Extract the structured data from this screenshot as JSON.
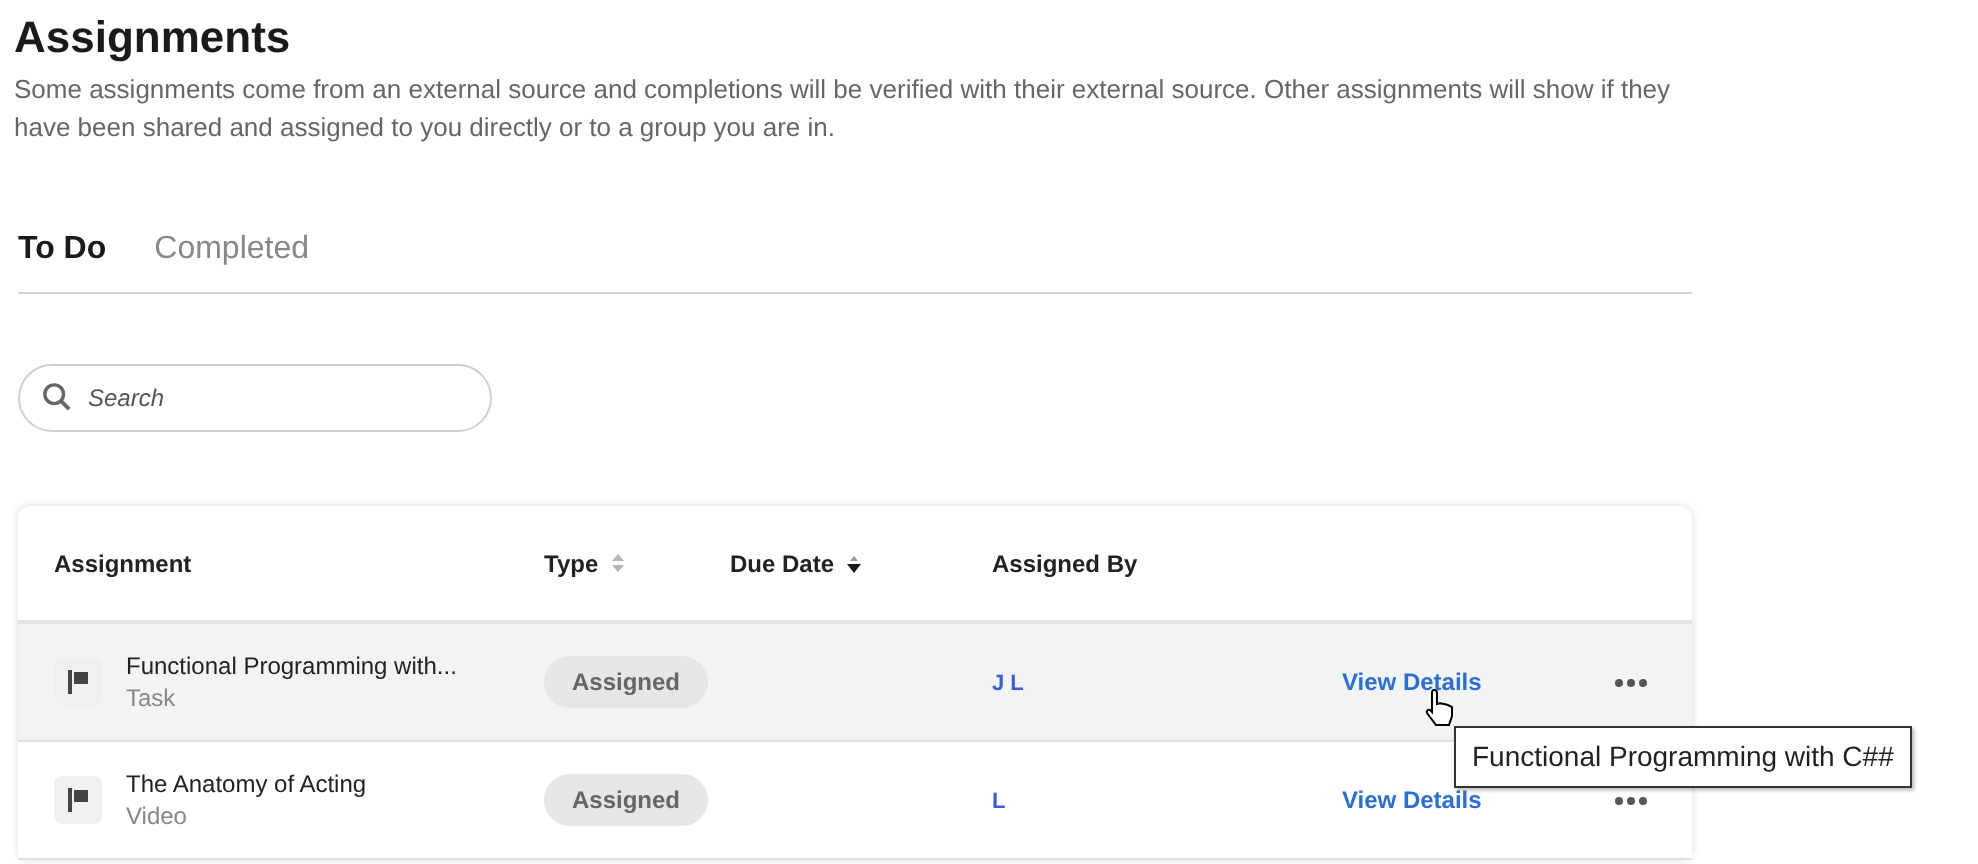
{
  "page": {
    "title": "Assignments",
    "description": "Some assignments come from an external source and completions will be verified with their external source. Other assignments will show if they have been shared and assigned to you directly or to a group you are in."
  },
  "tabs": [
    {
      "label": "To Do",
      "selected": true
    },
    {
      "label": "Completed",
      "selected": false
    }
  ],
  "search": {
    "placeholder": "Search"
  },
  "table": {
    "columns": [
      {
        "label": "Assignment",
        "sortable": false
      },
      {
        "label": "Type",
        "sortable": true,
        "sorted_descending": false
      },
      {
        "label": "Due Date",
        "sortable": true,
        "sorted_descending": true
      },
      {
        "label": "Assigned By",
        "sortable": false
      }
    ],
    "rows": [
      {
        "title": "Functional Programming with...",
        "subtitle": "Task",
        "type": "Assigned",
        "assigned_by": "J L",
        "action": "View Details",
        "hovered": true
      },
      {
        "title": "The Anatomy of Acting",
        "subtitle": "Video",
        "type": "Assigned",
        "assigned_by": "L",
        "action": "View Details",
        "hovered": false
      }
    ]
  },
  "tooltip": {
    "text": "Functional Programming with C##"
  }
}
